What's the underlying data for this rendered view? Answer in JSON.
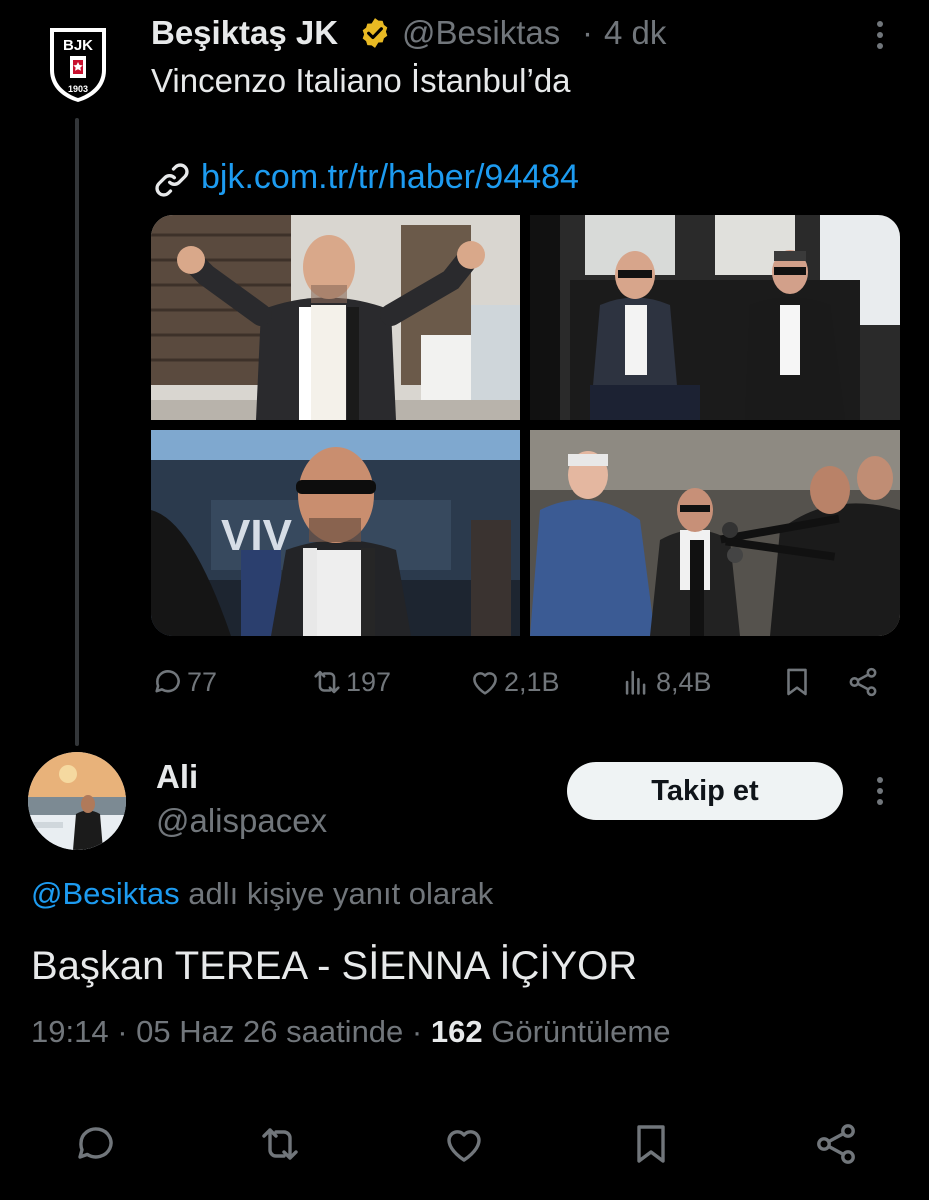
{
  "tweet": {
    "author_name": "Beşiktaş JK",
    "author_handle": "@Besiktas",
    "separator": "·",
    "time_ago": "4 dk",
    "text": "Vincenzo Italiano İstanbul’da",
    "link": "bjk.com.tr/tr/haber/94484",
    "verified_color": "#e8b923",
    "photos": [
      {
        "icon": "photo-coach-arms-raised"
      },
      {
        "icon": "photo-coach-in-vehicle"
      },
      {
        "icon": "photo-coach-sunglasses"
      },
      {
        "icon": "photo-press-crowd"
      }
    ],
    "actions": {
      "replies": "77",
      "retweets": "197",
      "likes": "2,1B",
      "views": "8,4B"
    }
  },
  "reply": {
    "author_name": "Ali",
    "author_handle": "@alispacex",
    "follow_label": "Takip et",
    "reply_to_mention": "@Besiktas",
    "reply_to_suffix": " adlı kişiye yanıt olarak",
    "text": "Başkan TEREA - SİENNA İÇİYOR",
    "time": "19:14",
    "date": "05 Haz 26 saatinde",
    "separator": "·",
    "views_count": "162",
    "views_label": "Görüntüleme"
  },
  "colors": {
    "background": "#000000",
    "primary_text": "#e7e9ea",
    "secondary_text": "#71767b",
    "link": "#1d9bf0",
    "button_bg": "#eff3f4"
  }
}
